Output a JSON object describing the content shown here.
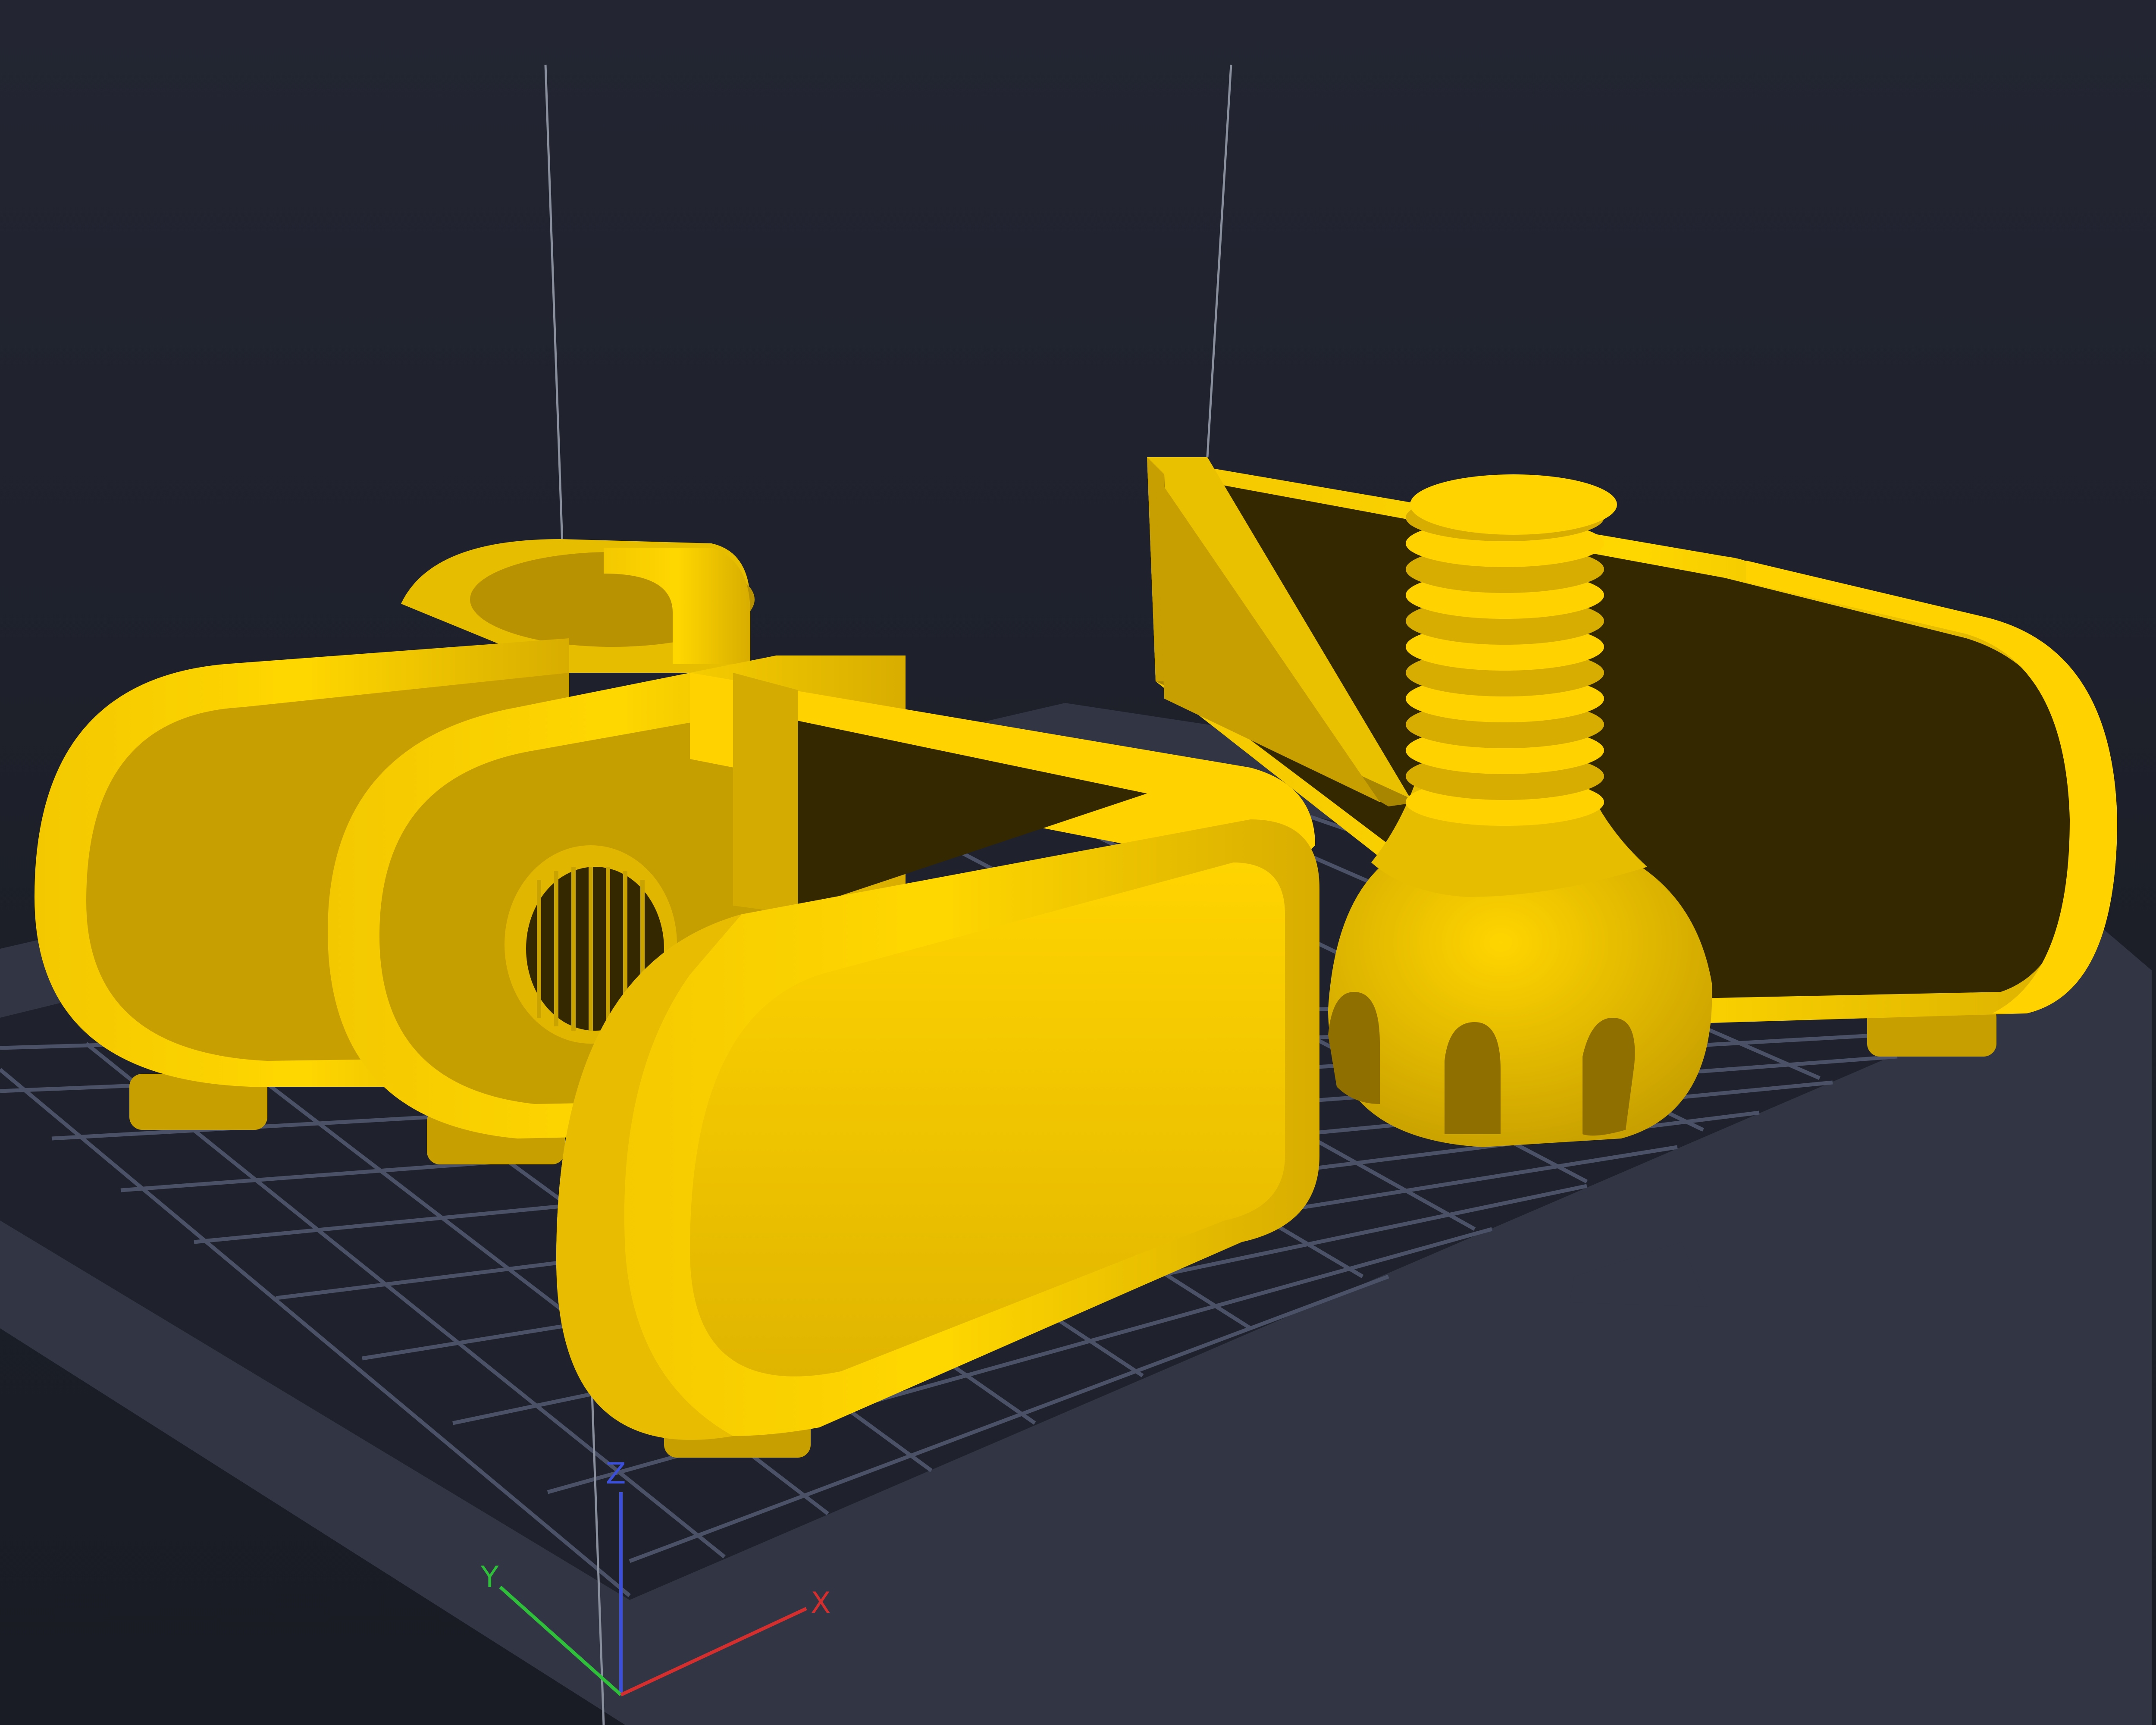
{
  "viewport": {
    "background": "#1d2029",
    "plate_color": "#313544",
    "grid_color": "#444a5c",
    "model_color": "#f2c400"
  },
  "axes": {
    "x": {
      "label": "X",
      "color": "#d32f2f"
    },
    "y": {
      "label": "Y",
      "color": "#2fbf3a"
    },
    "z": {
      "label": "Z",
      "color": "#3b4fd8"
    }
  },
  "models": [
    {
      "name": "hinge-arm-left",
      "type": "solid"
    },
    {
      "name": "square-clamp",
      "type": "solid"
    },
    {
      "name": "threaded-knob-screw",
      "type": "solid"
    },
    {
      "name": "hinge-arm-right",
      "type": "solid"
    }
  ]
}
